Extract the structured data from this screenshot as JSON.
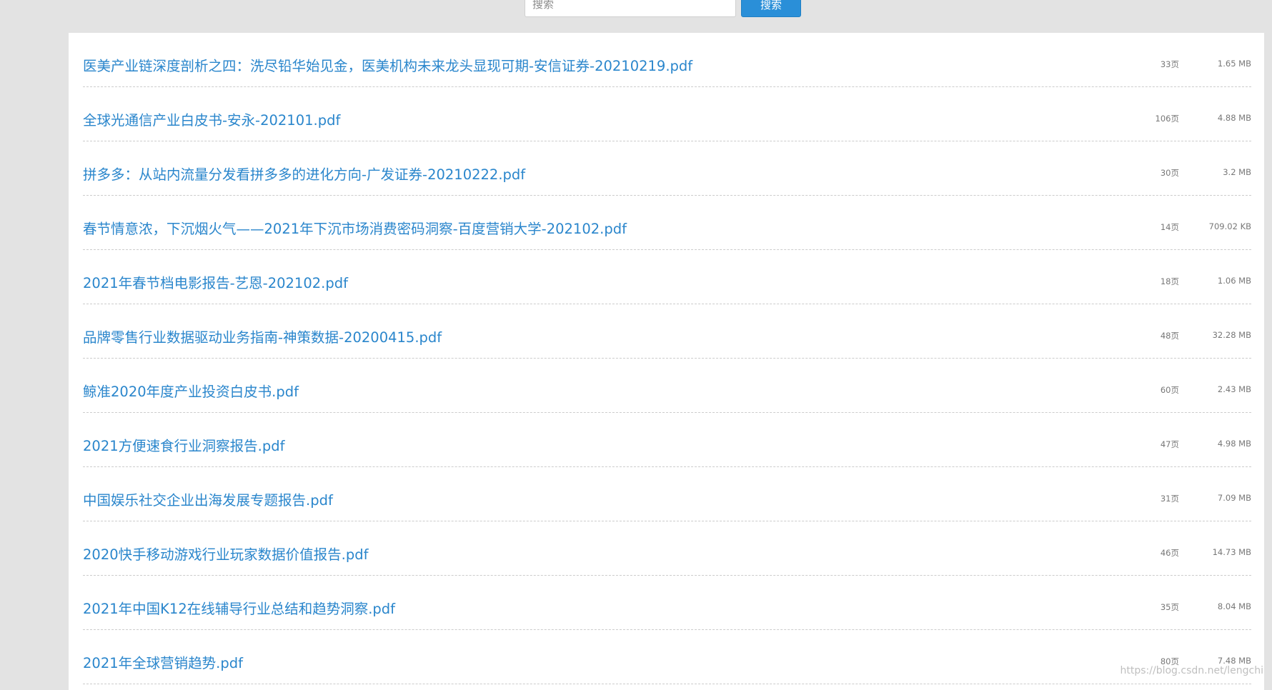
{
  "search": {
    "placeholder": "搜索",
    "button_label": "搜索"
  },
  "files": [
    {
      "title": "医美产业链深度剖析之四：洗尽铅华始见金，医美机构未来龙头显现可期-安信证券-20210219.pdf",
      "pages": "33页",
      "size": "1.65 MB"
    },
    {
      "title": "全球光通信产业白皮书-安永-202101.pdf",
      "pages": "106页",
      "size": "4.88 MB"
    },
    {
      "title": "拼多多：从站内流量分发看拼多多的进化方向-广发证券-20210222.pdf",
      "pages": "30页",
      "size": "3.2 MB"
    },
    {
      "title": "春节情意浓，下沉烟火气——2021年下沉市场消费密码洞察-百度营销大学-202102.pdf",
      "pages": "14页",
      "size": "709.02 KB"
    },
    {
      "title": "2021年春节档电影报告-艺恩-202102.pdf",
      "pages": "18页",
      "size": "1.06 MB"
    },
    {
      "title": "品牌零售行业数据驱动业务指南-神策数据-20200415.pdf",
      "pages": "48页",
      "size": "32.28 MB"
    },
    {
      "title": "鲸准2020年度产业投资白皮书.pdf",
      "pages": "60页",
      "size": "2.43 MB"
    },
    {
      "title": "2021方便速食行业洞察报告.pdf",
      "pages": "47页",
      "size": "4.98 MB"
    },
    {
      "title": "中国娱乐社交企业出海发展专题报告.pdf",
      "pages": "31页",
      "size": "7.09 MB"
    },
    {
      "title": "2020快手移动游戏行业玩家数据价值报告.pdf",
      "pages": "46页",
      "size": "14.73 MB"
    },
    {
      "title": "2021年中国K12在线辅导行业总结和趋势洞察.pdf",
      "pages": "35页",
      "size": "8.04 MB"
    },
    {
      "title": "2021年全球营销趋势.pdf",
      "pages": "80页",
      "size": "7.48 MB"
    }
  ],
  "watermark": "https://blog.csdn.net/lengchi"
}
